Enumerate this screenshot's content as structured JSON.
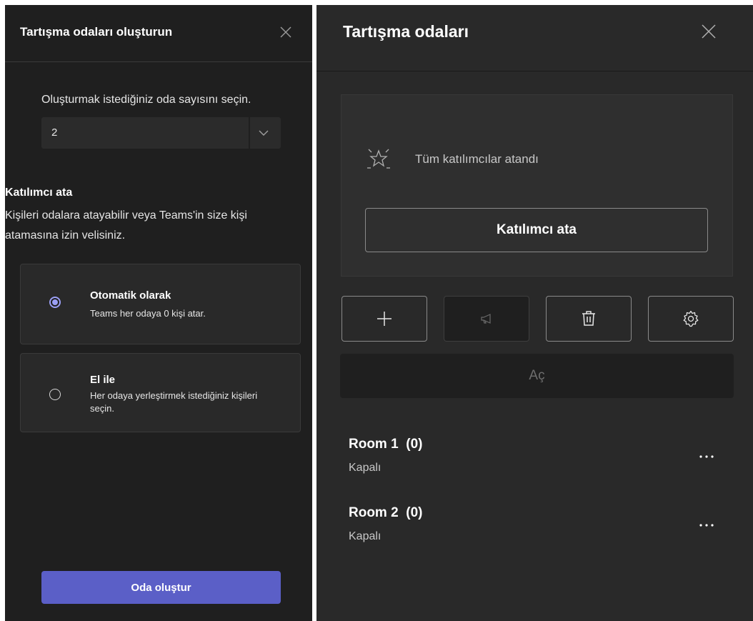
{
  "create_panel": {
    "title": "Tartışma odaları oluşturun",
    "room_count_label": "Oluşturmak istediğiniz oda sayısını seçin.",
    "room_count_value": "2",
    "assign_heading": "Katılımcı ata",
    "assign_description": "Kişileri odalara atayabilir veya Teams'in size kişi atamasına izin velisiniz.",
    "options": [
      {
        "title": "Otomatik olarak",
        "description": "Teams her odaya 0 kişi atar.",
        "selected": true
      },
      {
        "title": "El ile",
        "description": "Her odaya yerleştirmek istediğiniz kişileri seçin.",
        "selected": false
      }
    ],
    "create_button_label": "Oda oluştur"
  },
  "rooms_panel": {
    "title": "Tartışma odaları",
    "assigned_status": "Tüm katılımcılar atandı",
    "assign_button_label": "Katılımcı ata",
    "open_button_label": "Aç",
    "toolbar_icons": [
      "plus-icon",
      "megaphone-icon",
      "trash-icon",
      "gear-icon"
    ],
    "rooms": [
      {
        "name": "Room 1",
        "count": "(0)",
        "status": "Kapalı"
      },
      {
        "name": "Room 2",
        "count": "(0)",
        "status": "Kapalı"
      }
    ]
  },
  "colors": {
    "accent": "#5b5fc7",
    "radio_selected": "#9b9ff5",
    "left_background": "#1f1f1f",
    "right_background": "#292929"
  }
}
